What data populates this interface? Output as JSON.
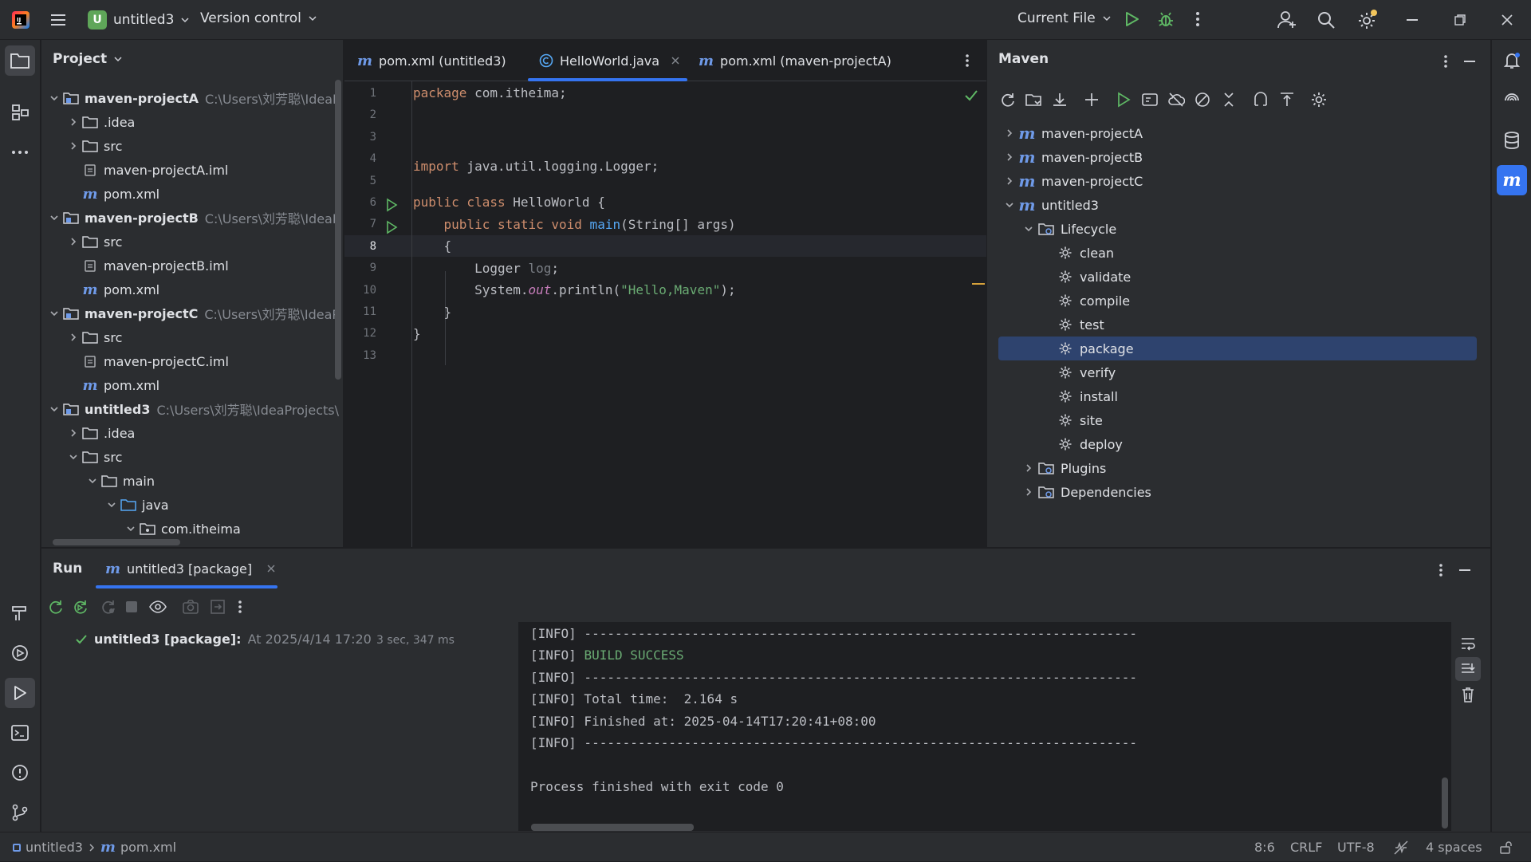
{
  "titlebar": {
    "project_badge": "U",
    "project_name": "untitled3",
    "vcs_label": "Version control",
    "run_config": "Current File"
  },
  "project_panel": {
    "title": "Project",
    "rows": [
      {
        "label": "maven-projectA",
        "path": "C:\\Users\\刘芳聪\\IdeaP",
        "bold": true
      },
      {
        "label": ".idea"
      },
      {
        "label": "src"
      },
      {
        "label": "maven-projectA.iml"
      },
      {
        "label": "pom.xml"
      },
      {
        "label": "maven-projectB",
        "path": "C:\\Users\\刘芳聪\\IdeaP",
        "bold": true
      },
      {
        "label": "src"
      },
      {
        "label": "maven-projectB.iml"
      },
      {
        "label": "pom.xml"
      },
      {
        "label": "maven-projectC",
        "path": "C:\\Users\\刘芳聪\\IdeaP",
        "bold": true
      },
      {
        "label": "src"
      },
      {
        "label": "maven-projectC.iml"
      },
      {
        "label": "pom.xml"
      },
      {
        "label": "untitled3",
        "path": "C:\\Users\\刘芳聪\\IdeaProjects\\",
        "bold": true
      },
      {
        "label": ".idea"
      },
      {
        "label": "src"
      },
      {
        "label": "main"
      },
      {
        "label": "java"
      },
      {
        "label": "com.itheima"
      }
    ]
  },
  "editor": {
    "tabs": [
      {
        "label": "pom.xml (untitled3)"
      },
      {
        "label": "HelloWorld.java",
        "active": true
      },
      {
        "label": "pom.xml (maven-projectA)"
      }
    ],
    "line_numbers": [
      "1",
      "2",
      "3",
      "4",
      "5",
      "6",
      "7",
      "8",
      "9",
      "10",
      "11",
      "12",
      "13"
    ],
    "code": {
      "l1_kw": "package",
      "l1_rest": " com.itheima;",
      "l4_kw": "import",
      "l4_rest": " java.util.logging.Logger;",
      "l6_kw": "public class",
      "l6_rest": " HelloWorld {",
      "l7_indent": "    ",
      "l7_kw": "public static void",
      "l7_fn": " main",
      "l7_rest": "(String[] args)",
      "l8": "    {",
      "l9_type": "        Logger ",
      "l9_var": "log",
      "l9_end": ";",
      "l10_a": "        System.",
      "l10_out": "out",
      "l10_b": ".println(",
      "l10_str": "\"Hello,Maven\"",
      "l10_c": ");",
      "l11": "    }",
      "l12": "}"
    }
  },
  "maven": {
    "title": "Maven",
    "rows": [
      {
        "label": "maven-projectA"
      },
      {
        "label": "maven-projectB"
      },
      {
        "label": "maven-projectC"
      },
      {
        "label": "untitled3"
      },
      {
        "label": "Lifecycle"
      },
      {
        "label": "clean"
      },
      {
        "label": "validate"
      },
      {
        "label": "compile"
      },
      {
        "label": "test"
      },
      {
        "label": "package",
        "selected": true
      },
      {
        "label": "verify"
      },
      {
        "label": "install"
      },
      {
        "label": "site"
      },
      {
        "label": "deploy"
      },
      {
        "label": "Plugins"
      },
      {
        "label": "Dependencies"
      }
    ]
  },
  "run": {
    "title": "Run",
    "tab_label": "untitled3 [package]",
    "tree_item": "untitled3 [package]:",
    "tree_time": "At 2025/4/14 17:20",
    "tree_duration": "3 sec, 347 ms",
    "console": {
      "line1": "[INFO] ------------------------------------------------------------------------",
      "line2_prefix": "[INFO] ",
      "line2_success": "BUILD SUCCESS",
      "line3": "[INFO] ------------------------------------------------------------------------",
      "line4": "[INFO] Total time:  2.164 s",
      "line5": "[INFO] Finished at: 2025-04-14T17:20:41+08:00",
      "line6": "[INFO] ------------------------------------------------------------------------",
      "line7": "Process finished with exit code 0"
    }
  },
  "statusbar": {
    "crumb_project": "untitled3",
    "crumb_file": "pom.xml",
    "position": "8:6",
    "line_sep": "CRLF",
    "encoding": "UTF-8",
    "indent": "4 spaces"
  },
  "colors": {
    "accent": "#3574f0",
    "selection": "#2e436e",
    "success": "#5fb865",
    "maven_m": "#6f9ae8"
  }
}
